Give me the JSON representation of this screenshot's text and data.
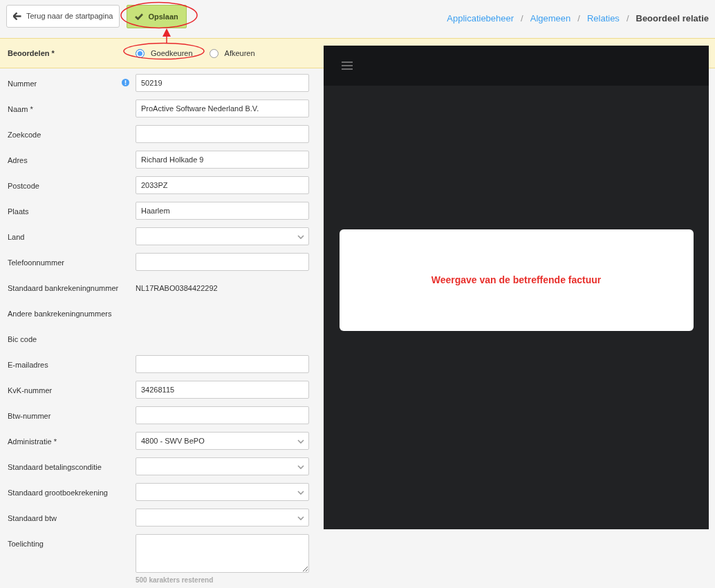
{
  "toolbar": {
    "back_button": "Terug naar de startpagina",
    "save_button": "Opslaan"
  },
  "breadcrumb": {
    "separator": "/",
    "items": [
      {
        "label": "Applicatiebeheer",
        "current": false
      },
      {
        "label": "Algemeen",
        "current": false
      },
      {
        "label": "Relaties",
        "current": false
      },
      {
        "label": "Beoordeel relatie",
        "current": true
      }
    ]
  },
  "review": {
    "label": "Beoordelen *",
    "options": [
      {
        "label": "Goedkeuren",
        "selected": true
      },
      {
        "label": "Afkeuren",
        "selected": false
      }
    ]
  },
  "fields": [
    {
      "label": "Nummer",
      "kind": "input",
      "value": "50219",
      "info_icon": true
    },
    {
      "label": "Naam *",
      "kind": "input",
      "value": "ProActive Software Nederland B.V."
    },
    {
      "label": "Zoekcode",
      "kind": "input"
    },
    {
      "label": "Adres",
      "kind": "input",
      "value": "Richard Holkade 9"
    },
    {
      "label": "Postcode",
      "kind": "input",
      "value": "2033PZ"
    },
    {
      "label": "Plaats",
      "kind": "input",
      "value": "Haarlem"
    },
    {
      "label": "Land",
      "kind": "select"
    },
    {
      "label": "Telefoonnummer",
      "kind": "input"
    },
    {
      "label": "Standaard bankrekeningnummer",
      "kind": "text",
      "value": "NL17RABO0384422292"
    },
    {
      "label": "Andere bankrekeningnummers",
      "kind": "none"
    },
    {
      "label": "Bic code",
      "kind": "none"
    },
    {
      "label": "E-mailadres",
      "kind": "input"
    },
    {
      "label": "KvK-nummer",
      "kind": "input",
      "value": "34268115"
    },
    {
      "label": "Btw-nummer",
      "kind": "input"
    },
    {
      "label": "Administratie *",
      "kind": "select",
      "value": "4800 - SWV BePO"
    },
    {
      "label": "Standaard betalingsconditie",
      "kind": "select"
    },
    {
      "label": "Standaard grootboekrekening",
      "kind": "select"
    },
    {
      "label": "Standaard btw",
      "kind": "select"
    },
    {
      "label": "Toelichting",
      "kind": "textarea",
      "hint": "500 karakters resterend"
    }
  ],
  "viewer": {
    "message": "Weergave van de betreffende factuur"
  }
}
